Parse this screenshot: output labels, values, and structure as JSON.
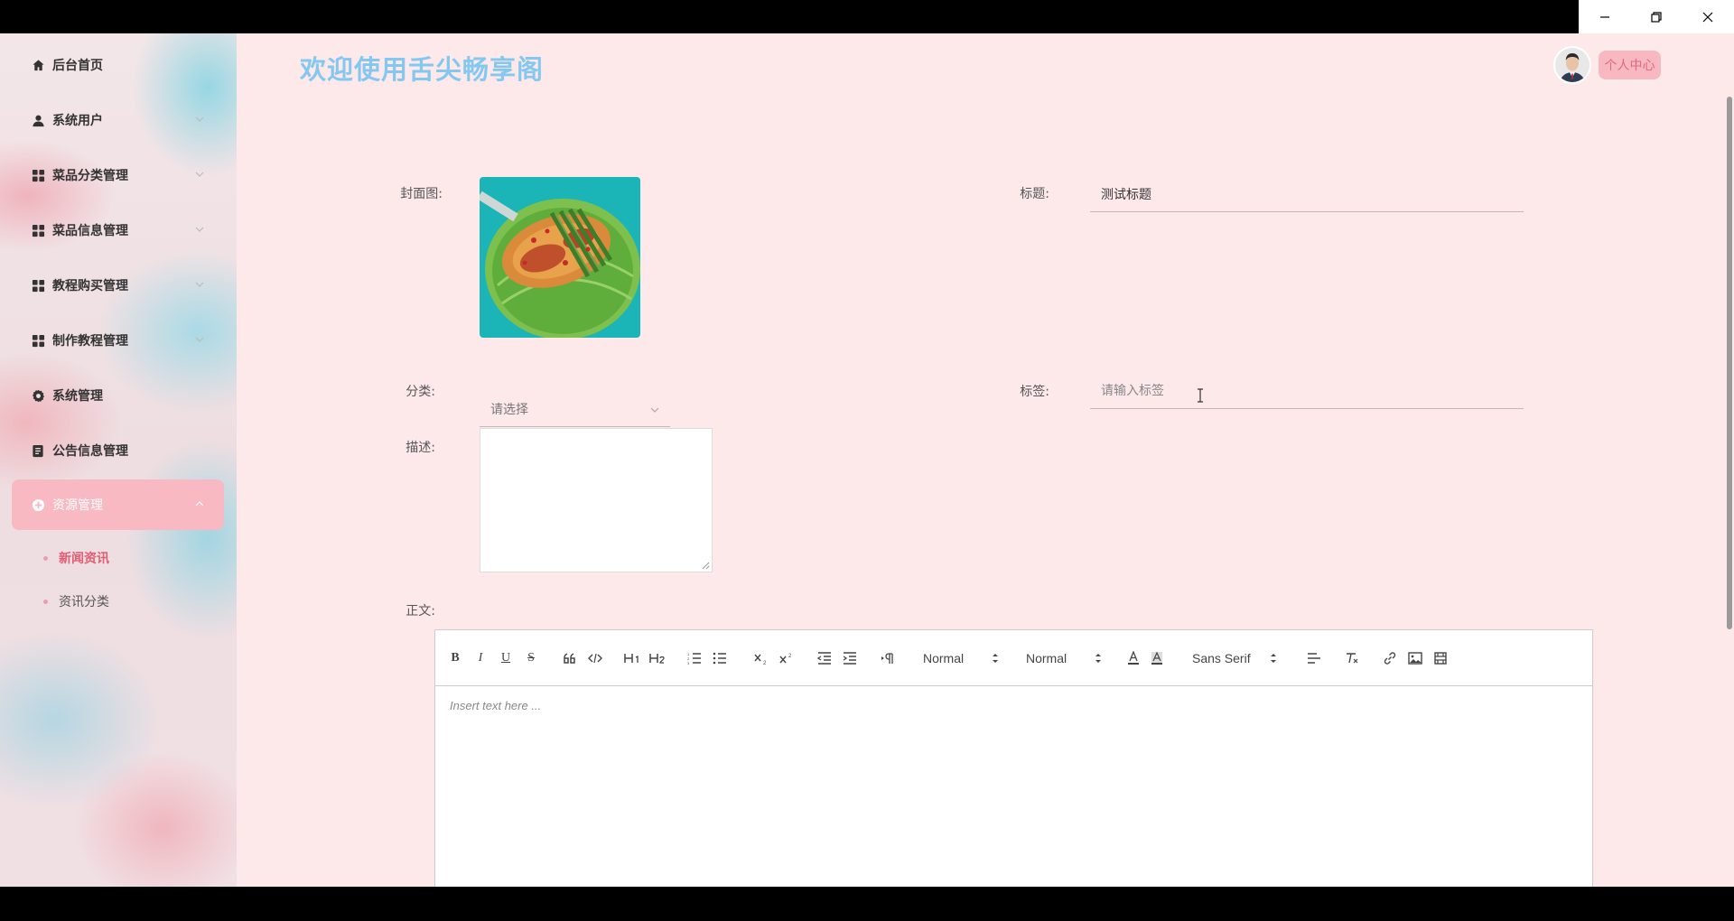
{
  "app": {
    "welcome_title": "欢迎使用舌尖畅享阁",
    "profile_button": "个人中心"
  },
  "sidebar": {
    "items": [
      {
        "label": "后台首页",
        "icon": "home-icon"
      },
      {
        "label": "系统用户",
        "icon": "user-icon"
      },
      {
        "label": "菜品分类管理",
        "icon": "grid-icon"
      },
      {
        "label": "菜品信息管理",
        "icon": "grid-icon"
      },
      {
        "label": "教程购买管理",
        "icon": "grid-icon"
      },
      {
        "label": "制作教程管理",
        "icon": "grid-icon"
      },
      {
        "label": "系统管理",
        "icon": "gear-icon"
      },
      {
        "label": "公告信息管理",
        "icon": "document-icon"
      },
      {
        "label": "资源管理",
        "icon": "resource-icon",
        "active": true
      }
    ],
    "subitems": [
      {
        "label": "新闻资讯",
        "active": true
      },
      {
        "label": "资讯分类"
      }
    ]
  },
  "form": {
    "cover_label": "封面图:",
    "title_label": "标题:",
    "title_value": "测试标题",
    "category_label": "分类:",
    "category_placeholder": "请选择",
    "tags_label": "标签:",
    "tags_placeholder": "请输入标签",
    "description_label": "描述:",
    "body_label": "正文:"
  },
  "editor": {
    "header_picker": "Normal",
    "size_picker": "Normal",
    "font_picker": "Sans Serif",
    "placeholder": "Insert text here ..."
  },
  "colors": {
    "background": "#fde8ea",
    "accent": "#f7b8c2",
    "welcome": "#84c8f0",
    "active_text": "#e45c72"
  }
}
